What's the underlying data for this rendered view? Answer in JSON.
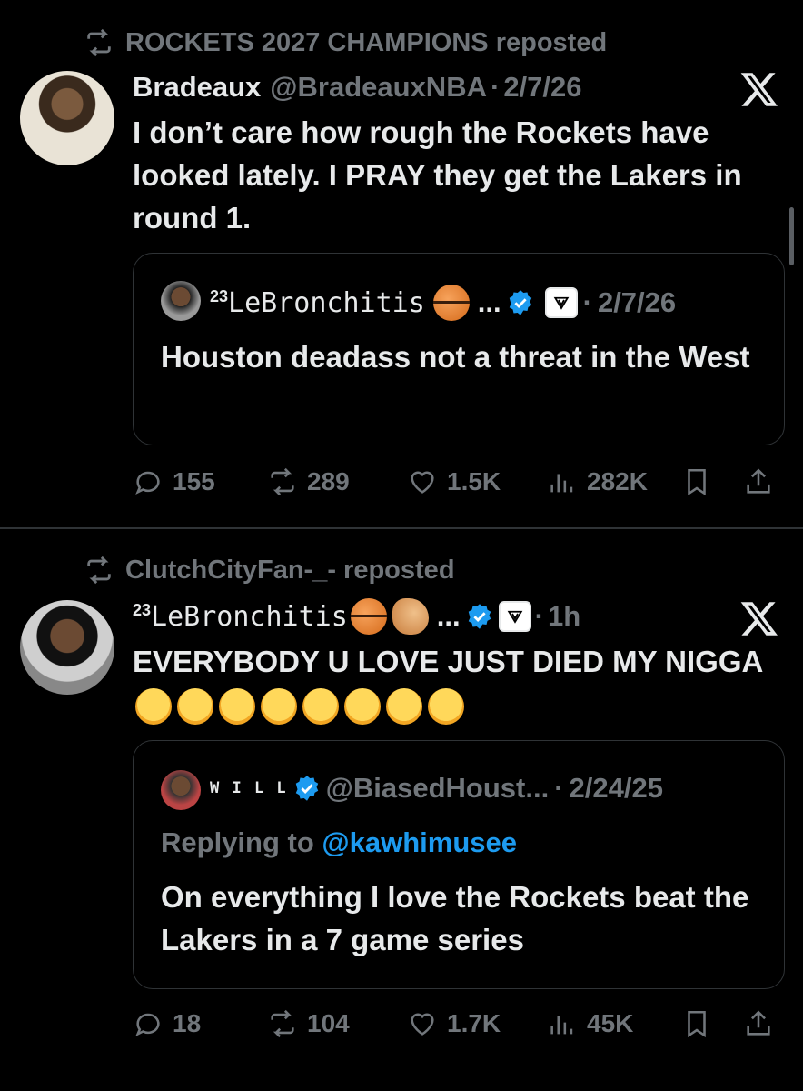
{
  "post1": {
    "repost_label": "ROCKETS 2027 CHAMPIONS reposted",
    "author_name": "Bradeaux",
    "author_handle": "@BradeauxNBA",
    "sep": "·",
    "date": "2/7/26",
    "text": "I don’t care how rough the Rockets have looked lately. I PRAY they get the Lakers in round 1.",
    "quote": {
      "name_sup": "23",
      "name": "LeBronchitis",
      "ellipsis": "...",
      "sep": "·",
      "date": "2/7/26",
      "text": "Houston deadass not a threat in the West"
    },
    "stats": {
      "replies": "155",
      "reposts": "289",
      "likes": "1.5K",
      "views": "282K"
    }
  },
  "post2": {
    "repost_label": "ClutchCityFan-_- reposted",
    "name_sup": "23",
    "author_name": "LeBronchitis",
    "ellipsis": "...",
    "sep": "·",
    "time": "1h",
    "text": "EVERYBODY U LOVE JUST DIED MY NIGGA",
    "quote": {
      "name": "W I L L",
      "handle": "@BiasedHoust...",
      "sep": "·",
      "date": "2/24/25",
      "replying_prefix": "Replying to ",
      "replying_handle": "@kawhimusee",
      "text": "On everything I love the Rockets beat the Lakers in a 7 game series"
    },
    "stats": {
      "replies": "18",
      "reposts": "104",
      "likes": "1.7K",
      "views": "45K"
    }
  },
  "colors": {
    "background": "#000000",
    "text": "#e7e9ea",
    "muted": "#71767b",
    "link": "#1d9bf0",
    "border": "#2f3336"
  }
}
